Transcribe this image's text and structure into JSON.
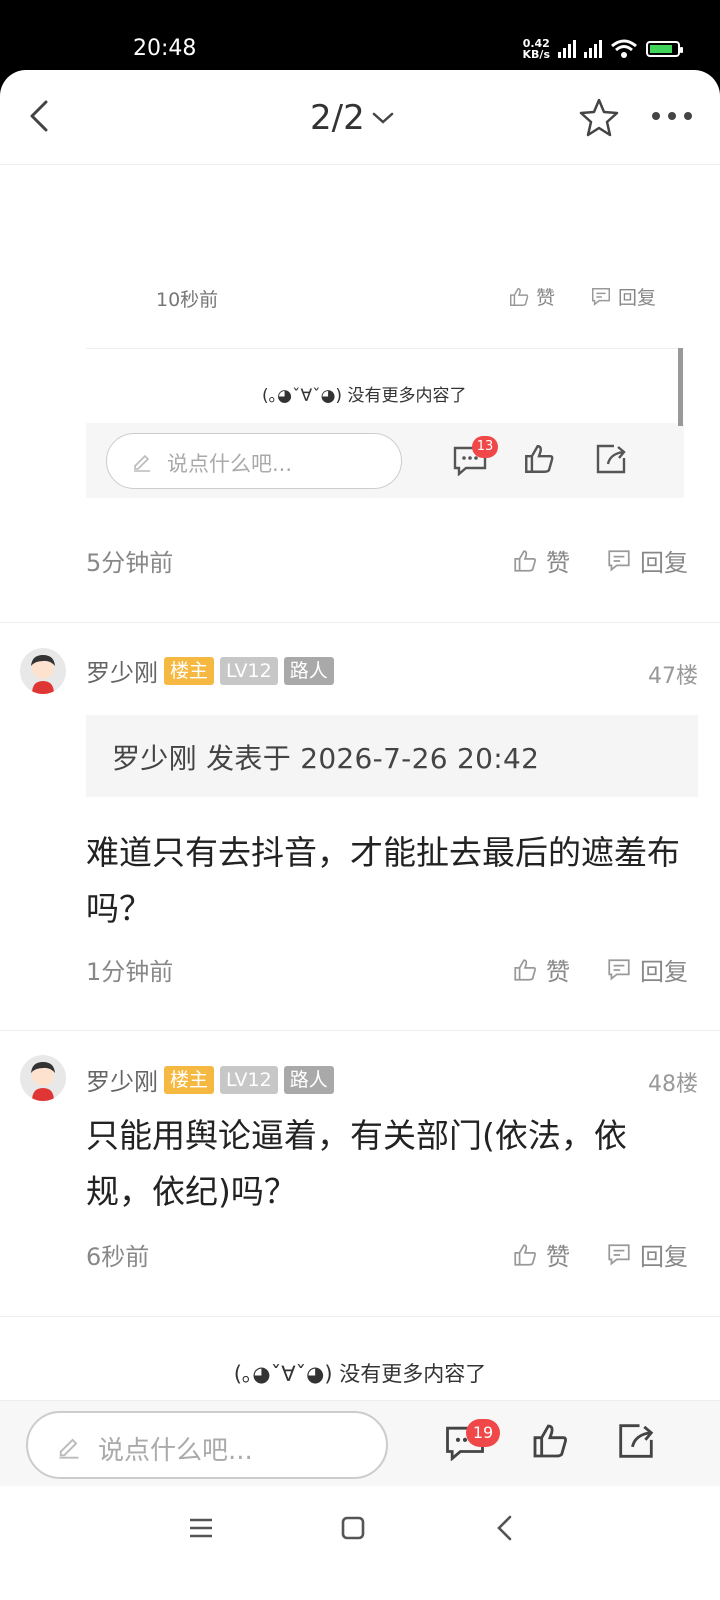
{
  "status_bar": {
    "time": "20:48",
    "net_speed_value": "0.42",
    "net_speed_unit": "KB/s"
  },
  "header": {
    "page_indicator": "2/2"
  },
  "previous_block": {
    "time": "10秒前",
    "like_label": "赞",
    "reply_label": "回复",
    "end_text": "(｡◕ˇ∀ˇ◕) 没有更多内容了",
    "input_placeholder": "说点什么吧...",
    "comment_count": "13"
  },
  "comments": [
    {
      "time": "5分钟前",
      "like_label": "赞",
      "reply_label": "回复"
    },
    {
      "user": "罗少刚",
      "host_badge": "楼主",
      "level_badge": "LV12",
      "role_badge": "路人",
      "floor": "47楼",
      "quote": "罗少刚 发表于 2026-7-26 20:42",
      "content": "难道只有去抖音，才能扯去最后的遮羞布吗？",
      "time": "1分钟前",
      "like_label": "赞",
      "reply_label": "回复"
    },
    {
      "user": "罗少刚",
      "host_badge": "楼主",
      "level_badge": "LV12",
      "role_badge": "路人",
      "floor": "48楼",
      "content": "只能用舆论逼着，有关部门(依法，依规，依纪)吗？",
      "time": "6秒前",
      "like_label": "赞",
      "reply_label": "回复"
    }
  ],
  "end_text": "(｡◕ˇ∀ˇ◕) 没有更多内容了",
  "bottom_bar": {
    "input_placeholder": "说点什么吧...",
    "comment_count": "19"
  }
}
